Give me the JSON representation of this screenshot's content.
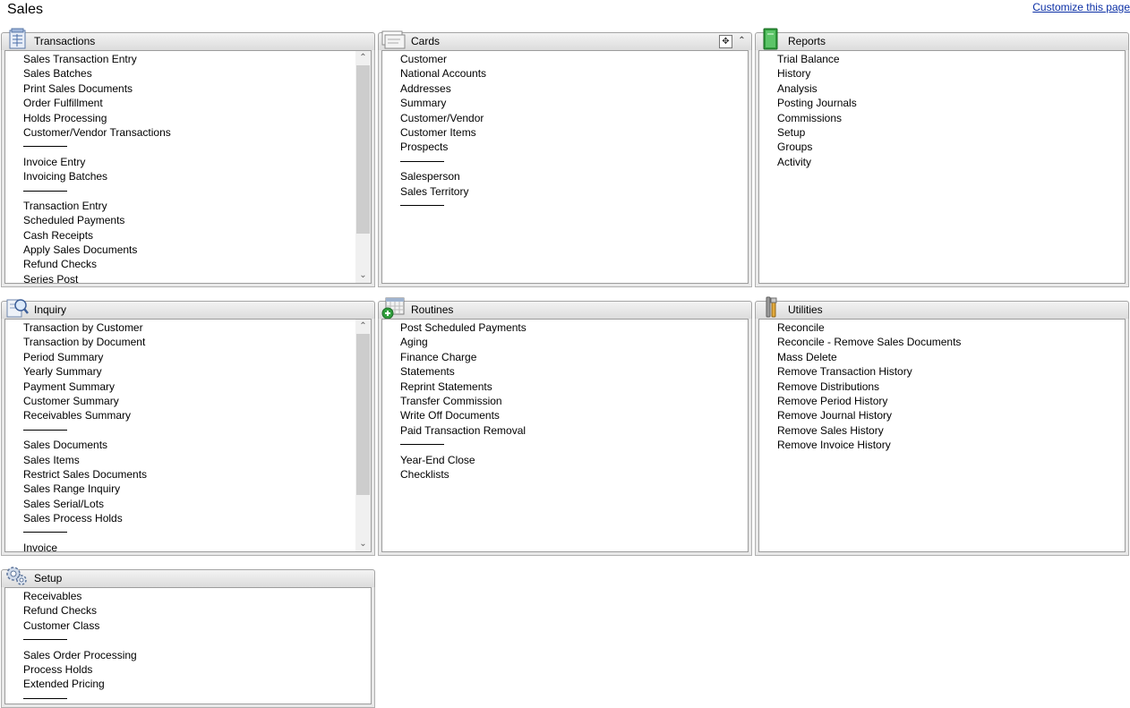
{
  "page": {
    "title": "Sales",
    "customize_label": "Customize this page"
  },
  "panels": {
    "transactions": {
      "title": "Transactions",
      "items": [
        "Sales Transaction Entry",
        "Sales Batches",
        "Print Sales Documents",
        "Order Fulfillment",
        "Holds Processing",
        "Customer/Vendor Transactions",
        "",
        "Invoice Entry",
        "Invoicing Batches",
        "",
        "Transaction Entry",
        "Scheduled Payments",
        "Cash Receipts",
        "Apply Sales Documents",
        "Refund Checks",
        "Series Post"
      ]
    },
    "cards": {
      "title": "Cards",
      "items": [
        "Customer",
        "National Accounts",
        "Addresses",
        "Summary",
        "Customer/Vendor",
        "Customer Items",
        "Prospects",
        "",
        "Salesperson",
        "Sales Territory",
        ""
      ]
    },
    "reports": {
      "title": "Reports",
      "items": [
        "Trial Balance",
        "History",
        "Analysis",
        "Posting Journals",
        "Commissions",
        "Setup",
        "Groups",
        "Activity"
      ]
    },
    "inquiry": {
      "title": "Inquiry",
      "items": [
        "Transaction by Customer",
        "Transaction by Document",
        "Period Summary",
        "Yearly Summary",
        "Payment Summary",
        "Customer Summary",
        "Receivables Summary",
        "",
        "Sales Documents",
        "Sales Items",
        "Restrict Sales Documents",
        "Sales Range Inquiry",
        "Sales Serial/Lots",
        "Sales Process Holds",
        "",
        "Invoice"
      ]
    },
    "routines": {
      "title": "Routines",
      "items": [
        "Post Scheduled Payments",
        "Aging",
        "Finance Charge",
        "Statements",
        "Reprint Statements",
        "Transfer Commission",
        "Write Off Documents",
        "Paid Transaction Removal",
        "",
        "Year-End Close",
        "Checklists"
      ]
    },
    "utilities": {
      "title": "Utilities",
      "items": [
        "Reconcile",
        "Reconcile - Remove Sales Documents",
        "Mass Delete",
        "Remove Transaction History",
        "Remove Distributions",
        "Remove Period History",
        "Remove Journal History",
        "Remove Sales History",
        "Remove Invoice History"
      ]
    },
    "setup": {
      "title": "Setup",
      "items": [
        "Receivables",
        "Refund Checks",
        "Customer Class",
        "",
        "Sales Order Processing",
        "Process Holds",
        "Extended Pricing",
        ""
      ]
    }
  },
  "icons": {
    "transactions": "transactions-icon",
    "cards": "cards-icon",
    "reports": "reports-book-icon",
    "inquiry": "inquiry-magnifier-icon",
    "routines": "routines-calendar-icon",
    "utilities": "utilities-tools-icon",
    "setup": "setup-gears-icon"
  },
  "colors": {
    "link": "#0b2fa5",
    "header_bg": "#e2e2e2",
    "panel_border": "#a4a4a4"
  }
}
